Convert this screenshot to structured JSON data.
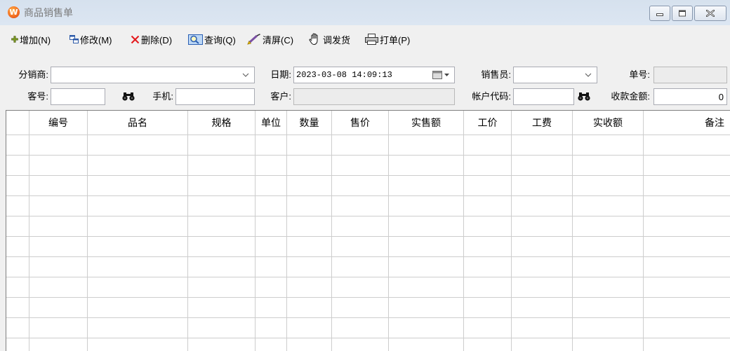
{
  "window": {
    "title": "商品销售单",
    "icon_letter": "W",
    "icon": "app-logo-icon",
    "controls": [
      "minimize-icon",
      "maximize-icon",
      "close-icon"
    ]
  },
  "toolbar": {
    "items": [
      {
        "label": "增加(N)",
        "icon": "plus-icon"
      },
      {
        "label": "修改(M)",
        "icon": "edit-icon"
      },
      {
        "label": "删除(D)",
        "icon": "delete-icon"
      },
      {
        "label": "查询(Q)",
        "icon": "search-icon"
      },
      {
        "label": "清屏(C)",
        "icon": "clear-icon"
      },
      {
        "label": "调发货",
        "icon": "hand-icon"
      },
      {
        "label": "打单(P)",
        "icon": "print-icon"
      }
    ]
  },
  "form": {
    "distributor": {
      "label": "分销商:",
      "value": ""
    },
    "date": {
      "label": "日期:",
      "value": "2023-03-08 14:09:13"
    },
    "salesperson": {
      "label": "销售员:",
      "value": ""
    },
    "order_no": {
      "label": "单号:",
      "value": ""
    },
    "customer_no": {
      "label": "客号:",
      "value": ""
    },
    "phone": {
      "label": "手机:",
      "value": ""
    },
    "customer": {
      "label": "客户:",
      "value": ""
    },
    "account_code": {
      "label": "帐户代码:",
      "value": ""
    },
    "amount_received": {
      "label": "收款金额:",
      "value": "0"
    }
  },
  "grid": {
    "columns": [
      "编号",
      "品名",
      "规格",
      "单位",
      "数量",
      "售价",
      "实售额",
      "工价",
      "工费",
      "实收额",
      "备注"
    ],
    "rows": []
  },
  "colors": {
    "title_bar": "#dce6f2",
    "window_bg": "#f0f0f0",
    "logo": "#f26a21",
    "delete": "#e3181c",
    "grid_line": "#cdcdcd"
  }
}
